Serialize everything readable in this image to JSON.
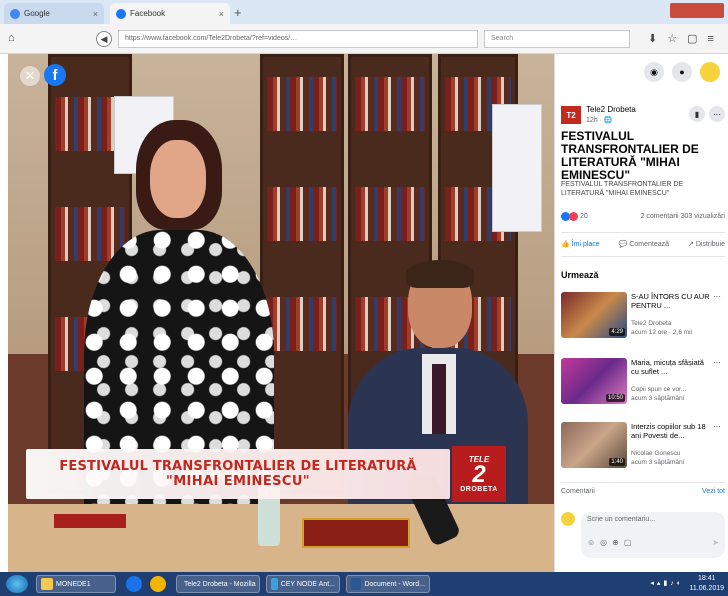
{
  "browser": {
    "tabs": [
      {
        "label": "Google"
      },
      {
        "label": "Facebook"
      }
    ],
    "url": "https://www.facebook.com/Tele2Drobeta/?ref=videos/…",
    "search_placeholder": "Search"
  },
  "video": {
    "banner_line1": "FESTIVALUL TRANSFRONTALIER DE LITERATURĂ",
    "banner_line2": "\"MIHAI EMINESCU\"",
    "logo_top": "TELE",
    "logo_num": "2",
    "logo_bottom": "DROBETA"
  },
  "post": {
    "page_name": "Tele2 Drobeta",
    "time": "12h · 🌐",
    "title": "FESTIVALUL TRANSFRONTALIER DE LITERATURĂ \"MIHAI EMINESCU\"",
    "description": "FESTIVALUL TRANSFRONTALIER DE LITERATURĂ \"MIHAI EMINESCU\"",
    "reactions_count": "20",
    "stats_right": "2 comentarii  303 vizualizări",
    "actions": [
      "Îmi place",
      "Comentează",
      "Distribuie"
    ]
  },
  "next_section": {
    "title": "Urmează",
    "videos": [
      {
        "title": "S-AU ÎNTORS CU AUR PENTRU ...",
        "channel": "Tele2 Drobeta",
        "meta": "acum 12 ore · 2,6 mii",
        "duration": "4:29"
      },
      {
        "title": "Maria, micuța sfâșiată cu suflet ...",
        "channel": "Copii spun ce vor...",
        "meta": "acum 3 săptămâni",
        "duration": "10:50"
      },
      {
        "title": "Interzis copiilor sub 18 ani Povesti de...",
        "channel": "Nicolae Gonescu",
        "meta": "acum 3 săptămâni",
        "duration": "1:40"
      }
    ]
  },
  "comments": {
    "label": "Comentarii",
    "view_all": "Vezi tot",
    "input_placeholder": "Scrie un comentariu..."
  },
  "taskbar": {
    "items": [
      "MONEDE1",
      "Tele2 Drobeta - Mozilla",
      "CEY NODE Ant...",
      "Document - Word..."
    ],
    "time": "18:41",
    "date": "11.06.2019"
  }
}
